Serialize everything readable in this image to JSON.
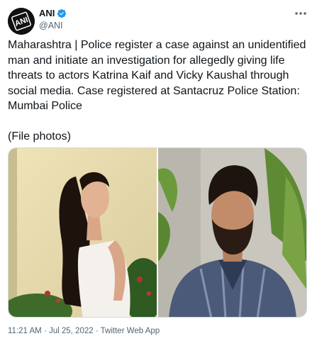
{
  "author": {
    "display_name": "ANI",
    "handle": "@ANI",
    "avatar_text": "ANI",
    "verified_icon": "verified-badge-icon",
    "verified_color": "#1d9bf0"
  },
  "tweet": {
    "text": "Maharashtra | Police register a case against an unidentified man and initiate an investigation for allegedly giving life threats to actors Katrina Kaif and Vicky Kaushal through social media. Case registered at Santacruz Police Station: Mumbai Police",
    "caption": "(File photos)"
  },
  "meta": {
    "time": "11:21 AM",
    "separator1": " · ",
    "date": "Jul 25, 2022",
    "separator2": " · ",
    "source": "Twitter Web App"
  },
  "icons": {
    "more": "more-options-icon"
  }
}
